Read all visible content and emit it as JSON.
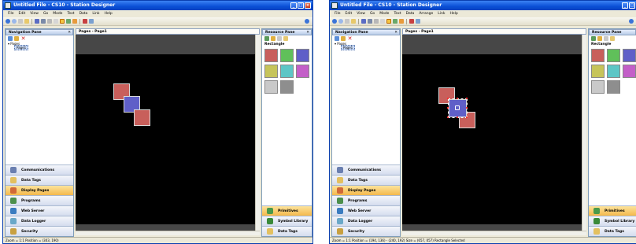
{
  "window": {
    "title": "Untitled File - CS10 - Station Designer"
  },
  "menu": [
    "File",
    "Edit",
    "View",
    "Go",
    "Mode",
    "Text",
    "Data",
    "Arrange",
    "Link",
    "Help"
  ],
  "nav": {
    "title": "Navigation Pane",
    "tree_root": "Pages",
    "tree_child": "Page1",
    "buttons": [
      "Communications",
      "Data Tags",
      "Display Pages",
      "Programs",
      "Web Server",
      "Data Logger",
      "Security"
    ],
    "active": "Display Pages"
  },
  "doc": {
    "tab": "Pages - Page1"
  },
  "resource": {
    "title": "Resource Pane",
    "section": "Rectangle",
    "buttons": [
      "Primitives",
      "Symbol Library",
      "Data Tags"
    ],
    "swatch_colors": [
      "#c85f5b",
      "#60c05a",
      "#5f5fc8",
      "#c6c45a",
      "#5ec6c6",
      "#c35fc8",
      "#c9c9c9",
      "#8e8e8e"
    ]
  },
  "status": {
    "left": "Zoom = 1:1  Position = (303, 190)",
    "right": "Zoom = 1:1  Position = (194, 136) - (240, 192)  Size = (657, 057)  Rectangle Selected"
  },
  "shapes": {
    "red": "#c85f5b",
    "blue": "#5f5fc8"
  }
}
